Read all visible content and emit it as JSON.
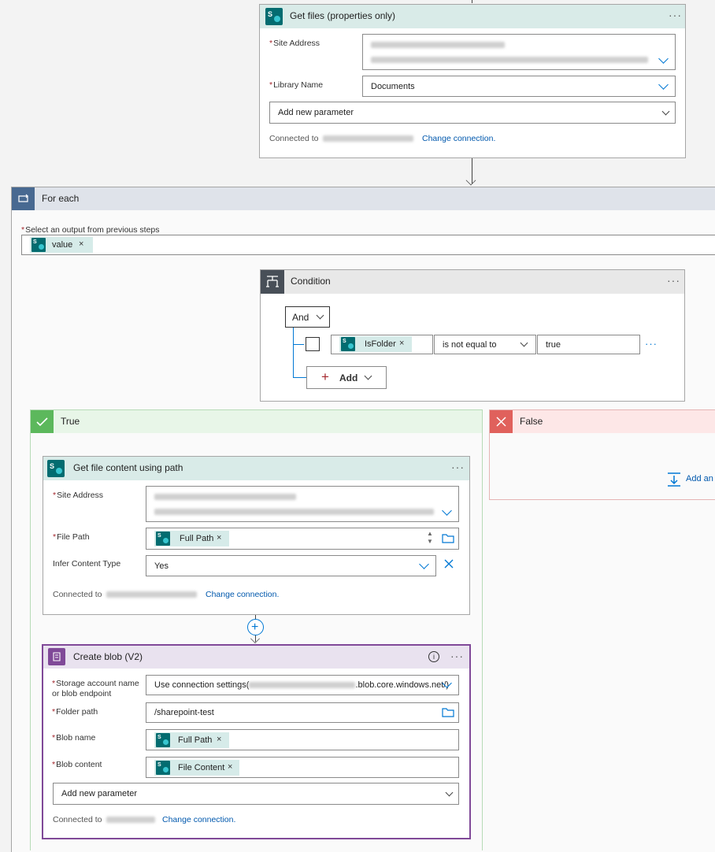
{
  "get_files": {
    "title": "Get files (properties only)",
    "site_address_label": "Site Address",
    "library_name_label": "Library Name",
    "library_name_value": "Documents",
    "add_param": "Add new parameter",
    "connected_to": "Connected to",
    "change_connection": "Change connection."
  },
  "for_each": {
    "title": "For each",
    "select_output_label": "Select an output from previous steps",
    "token": "value"
  },
  "condition": {
    "title": "Condition",
    "group_operator": "And",
    "token": "IsFolder",
    "operator": "is not equal to",
    "value": "true",
    "add_label": "Add"
  },
  "true_branch": {
    "title": "True"
  },
  "false_branch": {
    "title": "False",
    "add_action": "Add an"
  },
  "get_file_content": {
    "title": "Get file content using path",
    "site_address_label": "Site Address",
    "file_path_label": "File Path",
    "file_path_token": "Full Path",
    "infer_label": "Infer Content Type",
    "infer_value": "Yes",
    "connected_to": "Connected to",
    "change_connection": "Change connection."
  },
  "create_blob": {
    "title": "Create blob (V2)",
    "storage_label_1": "Storage account name",
    "storage_label_2": "or blob endpoint",
    "storage_value_prefix": "Use connection settings(",
    "storage_value_suffix": ".blob.core.windows.net/)",
    "folder_label": "Folder path",
    "folder_value": "/sharepoint-test",
    "blob_name_label": "Blob name",
    "blob_name_token": "Full Path",
    "blob_content_label": "Blob content",
    "blob_content_token": "File Content",
    "add_param": "Add new parameter",
    "connected_to": "Connected to",
    "change_connection": "Change connection."
  },
  "icons": {
    "sharepoint": "sharepoint-icon",
    "foreach": "loop-icon",
    "condition": "condition-icon",
    "true": "check-icon",
    "false": "close-icon",
    "blob": "storage-blob-icon"
  },
  "colors": {
    "sharepoint_header": "#d9ebe8",
    "foreach_header": "#dfe3ea",
    "foreach_icon_bg": "#486991",
    "condition_header": "#e8e8e8",
    "condition_icon_bg": "#484f58",
    "true_header": "#e8f6e8",
    "true_icon_bg": "#5cb85c",
    "false_header": "#fde7e7",
    "false_icon_bg": "#e0615c",
    "blob_header": "#e9e2ef",
    "blob_border": "#804998",
    "link": "#0058ad"
  }
}
